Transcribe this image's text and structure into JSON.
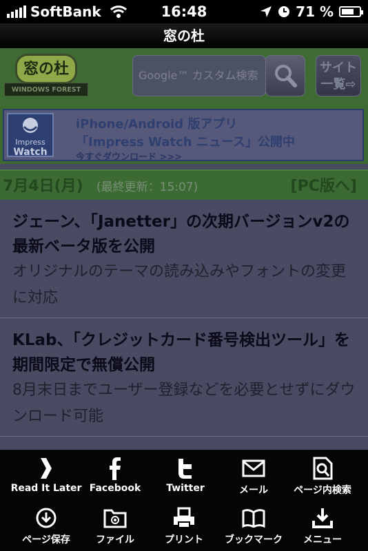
{
  "status_bar": {
    "carrier": "SoftBank",
    "time": "16:48",
    "battery": "71 %",
    "battery_level": 0.71
  },
  "window": {
    "title": "窓の杜"
  },
  "site_header": {
    "logo_text": "窓の杜",
    "logo_subtext": "WINDOWS FOREST",
    "search_placeholder": "Google™ カスタム検索",
    "sitemap_line1": "サイト",
    "sitemap_line2": "一覧⇨"
  },
  "banner": {
    "logo_line1": "Impress",
    "logo_line2": "Watch",
    "line1": "iPhone/Android 版アプリ",
    "line2": "「Impress Watch ニュース」公開中",
    "line3": "今すぐダウンロード >>>"
  },
  "date_bar": {
    "date": "7月4日(月)",
    "updated": "(最終更新：15:07)",
    "pc_link": "[PC版へ]"
  },
  "articles": [
    {
      "title": "ジェーン、「Janetter」の次期バージョンv2の最新ベータ版を公開",
      "summary": "オリジナルのテーマの読み込みやフォントの変更に対応"
    },
    {
      "title": "KLab、「クレジットカード番号検出ツール」を期間限定で無償公開",
      "summary": "8月末日までユーザー登録などを必要とせずにダウンロード可能"
    }
  ],
  "toolbar": {
    "row1": [
      {
        "label": "Read It Later",
        "icon": "read-it-later-icon"
      },
      {
        "label": "Facebook",
        "icon": "facebook-icon"
      },
      {
        "label": "Twitter",
        "icon": "twitter-icon"
      },
      {
        "label": "メール",
        "icon": "mail-icon"
      },
      {
        "label": "ページ内検索",
        "icon": "find-in-page-icon"
      }
    ],
    "row2": [
      {
        "label": "ページ保存",
        "icon": "save-page-icon"
      },
      {
        "label": "ファイル",
        "icon": "folder-icon"
      },
      {
        "label": "プリント",
        "icon": "print-icon"
      },
      {
        "label": "ブックマーク",
        "icon": "bookmark-icon"
      },
      {
        "label": "メニュー",
        "icon": "menu-icon"
      }
    ]
  }
}
